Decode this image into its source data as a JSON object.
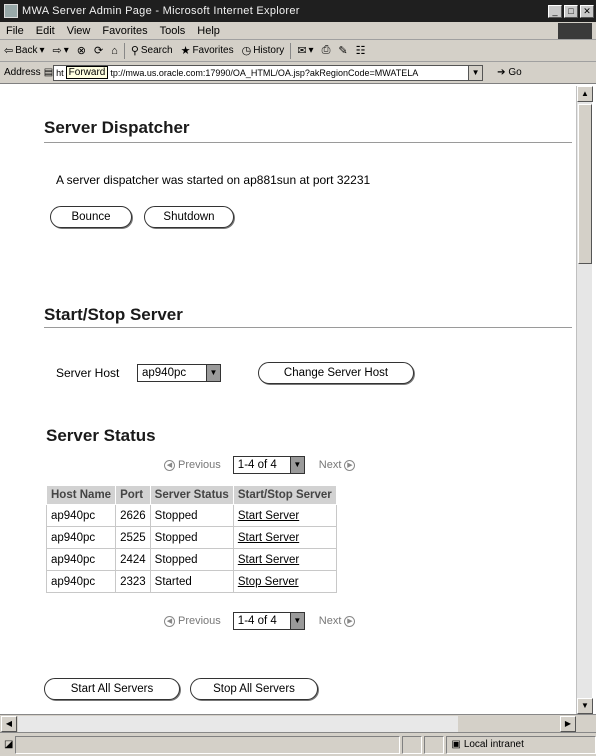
{
  "window": {
    "title": "MWA Server Admin Page - Microsoft Internet Explorer",
    "controls": [
      "_",
      "□",
      "✕"
    ]
  },
  "menu": [
    "File",
    "Edit",
    "View",
    "Favorites",
    "Tools",
    "Help"
  ],
  "toolbar": {
    "back": "Back",
    "search": "Search",
    "favorites": "Favorites",
    "history": "History"
  },
  "address": {
    "label": "Address",
    "tooltip": "Forward",
    "prefix": "ht",
    "url": "tp://mwa.us.oracle.com:17990/OA_HTML/OA.jsp?akRegionCode=MWATELA",
    "go": "Go"
  },
  "dispatcher": {
    "title": "Server Dispatcher",
    "message": "A server dispatcher was started on ap881sun at port 32231",
    "bounce_label": "Bounce",
    "shutdown_label": "Shutdown"
  },
  "startstop": {
    "title": "Start/Stop Server",
    "host_label": "Server Host",
    "host_value": "ap940pc",
    "change_host_label": "Change Server Host"
  },
  "status": {
    "title": "Server Status",
    "pager": {
      "previous": "Previous",
      "range": "1-4 of 4",
      "next": "Next"
    },
    "columns": [
      "Host Name",
      "Port",
      "Server Status",
      "Start/Stop Server"
    ],
    "rows": [
      {
        "host": "ap940pc",
        "port": "2626",
        "status": "Stopped",
        "action": "Start Server"
      },
      {
        "host": "ap940pc",
        "port": "2525",
        "status": "Stopped",
        "action": "Start Server"
      },
      {
        "host": "ap940pc",
        "port": "2424",
        "status": "Stopped",
        "action": "Start Server"
      },
      {
        "host": "ap940pc",
        "port": "2323",
        "status": "Started",
        "action": "Stop Server"
      }
    ],
    "start_all_label": "Start All Servers",
    "stop_all_label": "Stop All Servers"
  },
  "statusbar": {
    "zone": "Local intranet"
  },
  "colors": {
    "title_bar": "#1f1f1f",
    "chrome": "#d4d0c8",
    "table_header": "#d2d2d2"
  }
}
